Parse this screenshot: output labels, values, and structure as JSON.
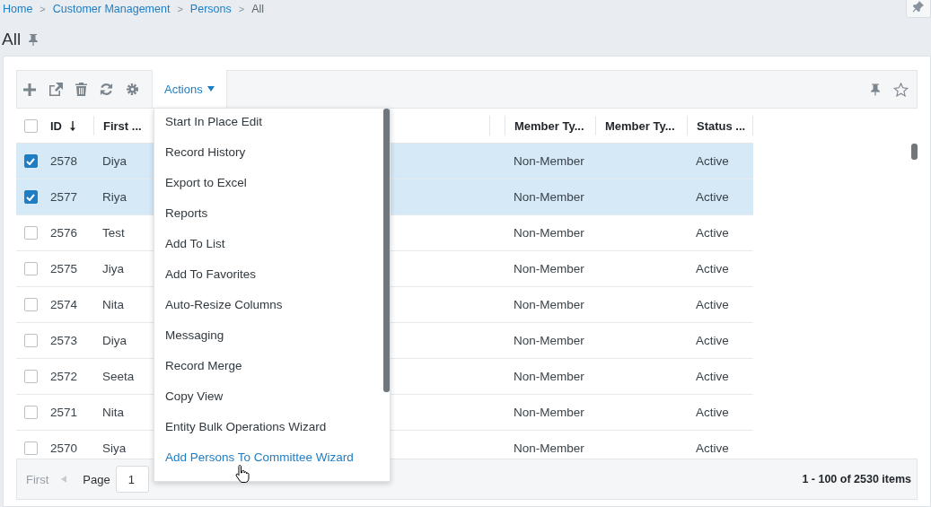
{
  "breadcrumb": [
    {
      "kind": "link",
      "label": "Home"
    },
    {
      "kind": "separator",
      "label": ">"
    },
    {
      "kind": "link",
      "label": "Customer Management"
    },
    {
      "kind": "separator",
      "label": ">"
    },
    {
      "kind": "link",
      "label": "Persons"
    },
    {
      "kind": "separator",
      "label": ">"
    },
    {
      "kind": "current",
      "label": "All"
    }
  ],
  "page_title": "All",
  "toolbar": {
    "actions_label": "Actions",
    "actions_expanded": true
  },
  "table": {
    "select_all_checked": false,
    "columns": [
      {
        "label": "ID",
        "sorted": true
      },
      {
        "label": "First ...",
        "sorted": false
      },
      {
        "label": "Member Ty...",
        "sorted": false
      },
      {
        "label": "Member Ty...",
        "sorted": false
      },
      {
        "label": "Status ...",
        "sorted": false
      }
    ],
    "rows": [
      {
        "id": "2578",
        "first_name": "Diya",
        "member_type": "Non-Member",
        "status": "Active",
        "selected": true
      },
      {
        "id": "2577",
        "first_name": "Riya",
        "member_type": "Non-Member",
        "status": "Active",
        "selected": true
      },
      {
        "id": "2576",
        "first_name": "Test",
        "member_type": "Non-Member",
        "status": "Active",
        "selected": false
      },
      {
        "id": "2575",
        "first_name": "Jiya",
        "member_type": "Non-Member",
        "status": "Active",
        "selected": false
      },
      {
        "id": "2574",
        "first_name": "Nita",
        "member_type": "Non-Member",
        "status": "Active",
        "selected": false
      },
      {
        "id": "2573",
        "first_name": "Diya",
        "member_type": "Non-Member",
        "status": "Active",
        "selected": false
      },
      {
        "id": "2572",
        "first_name": "Seeta",
        "member_type": "Non-Member",
        "status": "Active",
        "selected": false
      },
      {
        "id": "2571",
        "first_name": "Nita",
        "member_type": "Non-Member",
        "status": "Active",
        "selected": false
      },
      {
        "id": "2570",
        "first_name": "Siya",
        "member_type": "Non-Member",
        "status": "Active",
        "selected": false
      }
    ]
  },
  "actions_menu": [
    {
      "label": "Start In Place Edit",
      "selected": false
    },
    {
      "label": "Record History",
      "selected": false
    },
    {
      "label": "Export to Excel",
      "selected": false
    },
    {
      "label": "Reports",
      "selected": false
    },
    {
      "label": "Add To List",
      "selected": false
    },
    {
      "label": "Add To Favorites",
      "selected": false
    },
    {
      "label": "Auto-Resize Columns",
      "selected": false
    },
    {
      "label": "Messaging",
      "selected": false
    },
    {
      "label": "Record Merge",
      "selected": false
    },
    {
      "label": "Copy View",
      "selected": false
    },
    {
      "label": "Entity Bulk Operations Wizard",
      "selected": false
    },
    {
      "label": "Add Persons To Committee Wizard",
      "selected": true
    }
  ],
  "pager": {
    "first": "First",
    "first_disabled": true,
    "page_label": "Page",
    "page": "1",
    "summary": "1 - 100 of 2530 items"
  }
}
